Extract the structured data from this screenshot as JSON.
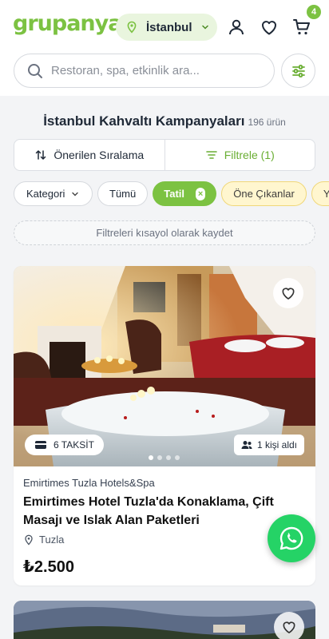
{
  "header": {
    "logo": "grupanya!",
    "city": "İstanbul",
    "cart_count": "4",
    "icons": [
      "location-pin-icon",
      "chevron-down-icon",
      "user-icon",
      "heart-icon",
      "cart-icon"
    ]
  },
  "search": {
    "placeholder": "Restoran, spa, etkinlik ara..."
  },
  "listing": {
    "title": "İstanbul Kahvaltı Kampanyaları",
    "count": "196 ürün",
    "sort_label": "Önerilen Sıralama",
    "filter_label": "Filtrele (1)",
    "save_filters": "Filtreleri kısayol olarak kaydet"
  },
  "chips": {
    "category": "Kategori",
    "all": "Tümü",
    "active": "Tatil",
    "featured": "Öne Çıkanlar",
    "partial": "Ye"
  },
  "card": {
    "installments": "6 TAKSİT",
    "sold": "1 kişi aldı",
    "merchant": "Emirtimes Tuzla Hotels&Spa",
    "title": "Emirtimes Hotel Tuzla'da Konaklama, Çift Masajı ve Islak Alan Paketleri",
    "location": "Tuzla",
    "price": "₺2.500",
    "carousel_index": 1,
    "carousel_total": 4
  },
  "colors": {
    "brand": "#7cc242",
    "whatsapp": "#25d366",
    "chip_yellow": "#fff6cf"
  }
}
